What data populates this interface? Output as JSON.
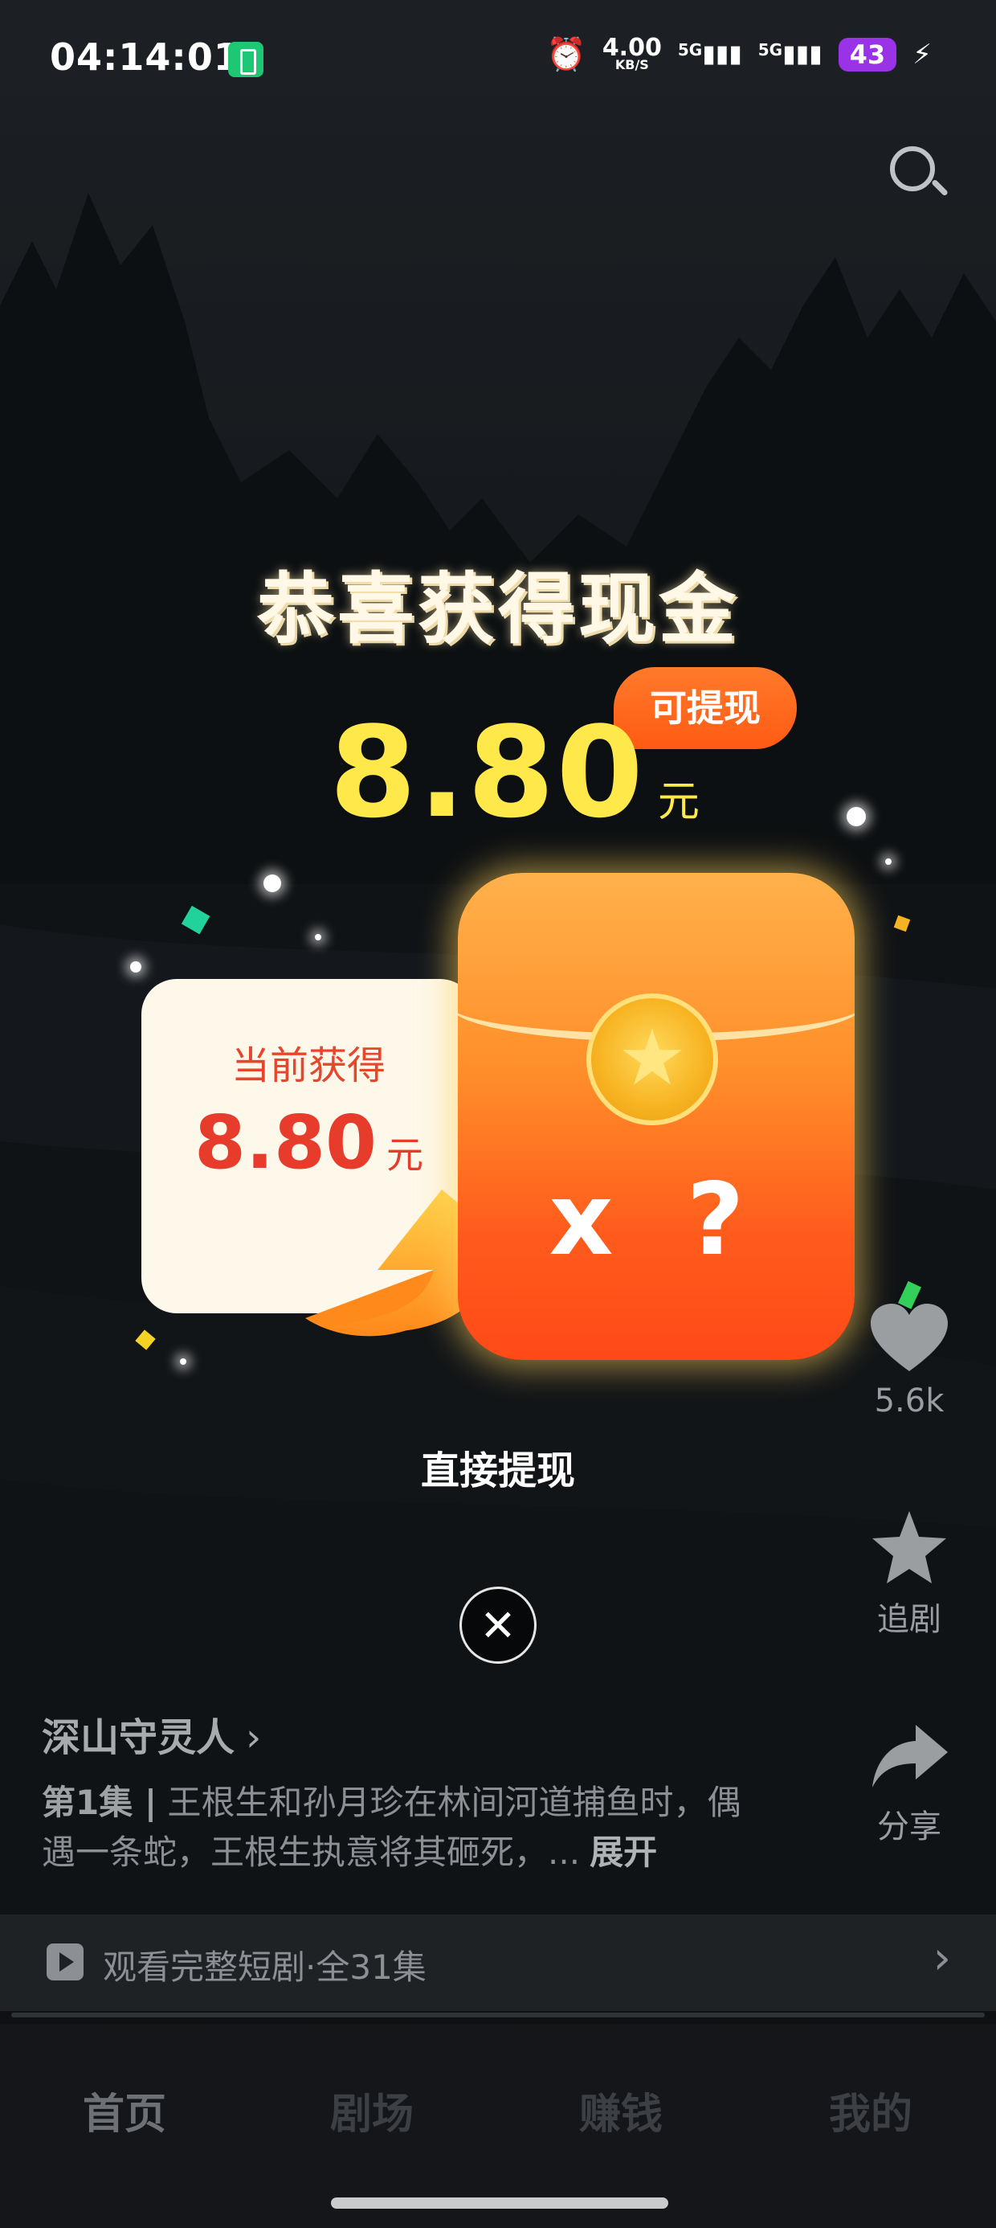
{
  "status_bar": {
    "time": "04:14:01",
    "net_speed": "4.00",
    "net_unit": "KB/S",
    "signal1": "5G",
    "signal2": "5G",
    "battery": "43"
  },
  "reward": {
    "title": "恭喜获得现金",
    "amount": "8.80",
    "unit": "元",
    "badge": "可提现",
    "card_label": "当前获得",
    "card_amount": "8.80",
    "card_unit": "元",
    "envelope_text": "x ?",
    "direct_withdraw": "直接提现"
  },
  "rail": {
    "like_count": "5.6k",
    "follow_label": "追剧",
    "share_label": "分享"
  },
  "drama": {
    "title": "深山守灵人",
    "episode": "第1集 |",
    "description": " 王根生和孙月珍在林间河道捕鱼时，偶遇一条蛇，王根生执意将其砸死，...",
    "expand": "展开",
    "watch_full": "观看完整短剧·全31集"
  },
  "tabs": [
    "首页",
    "剧场",
    "赚钱",
    "我的"
  ],
  "colors": {
    "accent_yellow": "#ffe84a",
    "accent_orange": "#ff5a14",
    "accent_red": "#e73b2c"
  }
}
